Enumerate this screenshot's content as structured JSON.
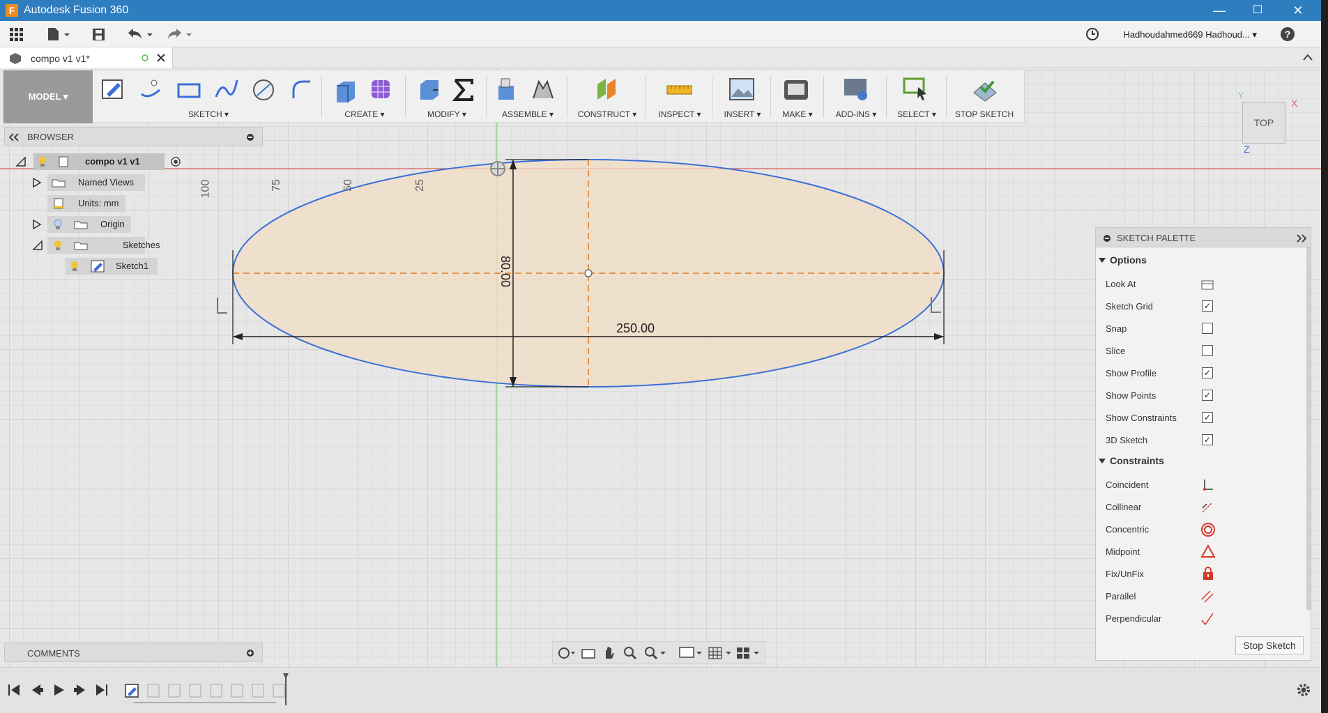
{
  "window": {
    "app_icon": "F",
    "title": "Autodesk Fusion 360",
    "minimize": "—",
    "maximize": "☐",
    "close": "✕"
  },
  "qat": {
    "user": "Hadhoudahmed669 Hadhoud... ▾",
    "help": "?"
  },
  "doc_tab": {
    "label": "compo v1 v1*"
  },
  "toolbar": {
    "workspace": "MODEL ▾",
    "groups": [
      "SKETCH ▾",
      "CREATE ▾",
      "MODIFY ▾",
      "ASSEMBLE ▾",
      "CONSTRUCT ▾",
      "INSPECT ▾",
      "INSERT ▾",
      "MAKE ▾",
      "ADD-INS ▾",
      "SELECT ▾",
      "STOP SKETCH"
    ]
  },
  "browser": {
    "title": "BROWSER",
    "items": [
      {
        "label": "compo v1 v1"
      },
      {
        "label": "Named Views"
      },
      {
        "label": "Units: mm"
      },
      {
        "label": "Origin"
      },
      {
        "label": "Sketches"
      },
      {
        "label": "Sketch1"
      }
    ]
  },
  "ruler": [
    "100",
    "75",
    "50",
    "25"
  ],
  "dimensions": {
    "horizontal": "250.00",
    "vertical": "80.00"
  },
  "viewcube": {
    "face": "TOP",
    "x": "X",
    "y": "Y",
    "z": "Z"
  },
  "palette": {
    "title": "SKETCH PALETTE",
    "options_header": "Options",
    "options": [
      {
        "label": "Look At",
        "checked": null
      },
      {
        "label": "Sketch Grid",
        "checked": true
      },
      {
        "label": "Snap",
        "checked": false
      },
      {
        "label": "Slice",
        "checked": false
      },
      {
        "label": "Show Profile",
        "checked": true
      },
      {
        "label": "Show Points",
        "checked": true
      },
      {
        "label": "Show Constraints",
        "checked": true
      },
      {
        "label": "3D Sketch",
        "checked": true
      }
    ],
    "constraints_header": "Constraints",
    "constraints": [
      {
        "label": "Coincident",
        "icon": "coincident-icon"
      },
      {
        "label": "Collinear",
        "icon": "collinear-icon"
      },
      {
        "label": "Concentric",
        "icon": "concentric-icon"
      },
      {
        "label": "Midpoint",
        "icon": "midpoint-icon"
      },
      {
        "label": "Fix/UnFix",
        "icon": "lock-icon"
      },
      {
        "label": "Parallel",
        "icon": "parallel-icon"
      },
      {
        "label": "Perpendicular",
        "icon": "perpendicular-icon"
      }
    ],
    "stop_button": "Stop Sketch"
  },
  "comments": {
    "title": "COMMENTS"
  },
  "colors": {
    "titlebar": "#2e7dbf",
    "profile_fill": "#f2dcc4",
    "sketch_line": "#3a6fd8",
    "construction": "#e07a1f",
    "constraint_red": "#d43a2a"
  }
}
